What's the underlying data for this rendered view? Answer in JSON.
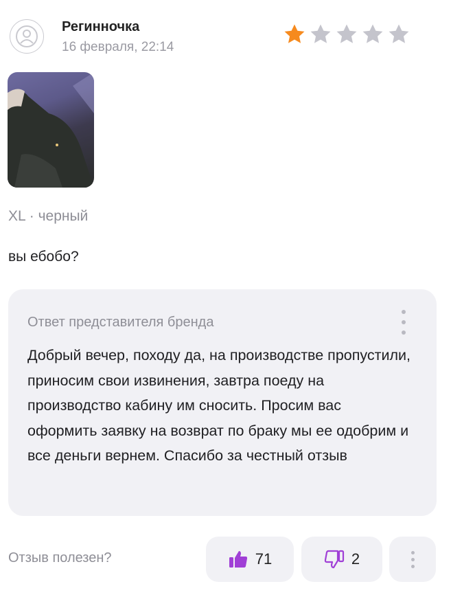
{
  "review": {
    "author": "Регинночка",
    "date": "16 февраля, 22:14",
    "rating": 1,
    "rating_max": 5,
    "variant": "XL · черный",
    "text": "вы ебобо?"
  },
  "brand_reply": {
    "title": "Ответ представителя бренда",
    "text": "Добрый вечер, походу да, на производстве пропустили, приносим свои извинения, завтра поеду на производство кабину им сносить. Просим вас оформить заявку на возврат по браку мы ее одобрим и все деньги вернем. Спасибо за честный отзыв"
  },
  "feedback": {
    "question": "Отзыв полезен?",
    "likes": "71",
    "dislikes": "2"
  },
  "icons": {
    "avatar": "user-icon",
    "star": "star-icon",
    "like": "thumbs-up-icon",
    "dislike": "thumbs-down-icon",
    "menu": "more-vertical-icon"
  },
  "colors": {
    "star_filled": "#f68a1e",
    "star_empty": "#c4c4cc",
    "accent": "#a03fd6",
    "panel_bg": "#f1f1f5"
  }
}
